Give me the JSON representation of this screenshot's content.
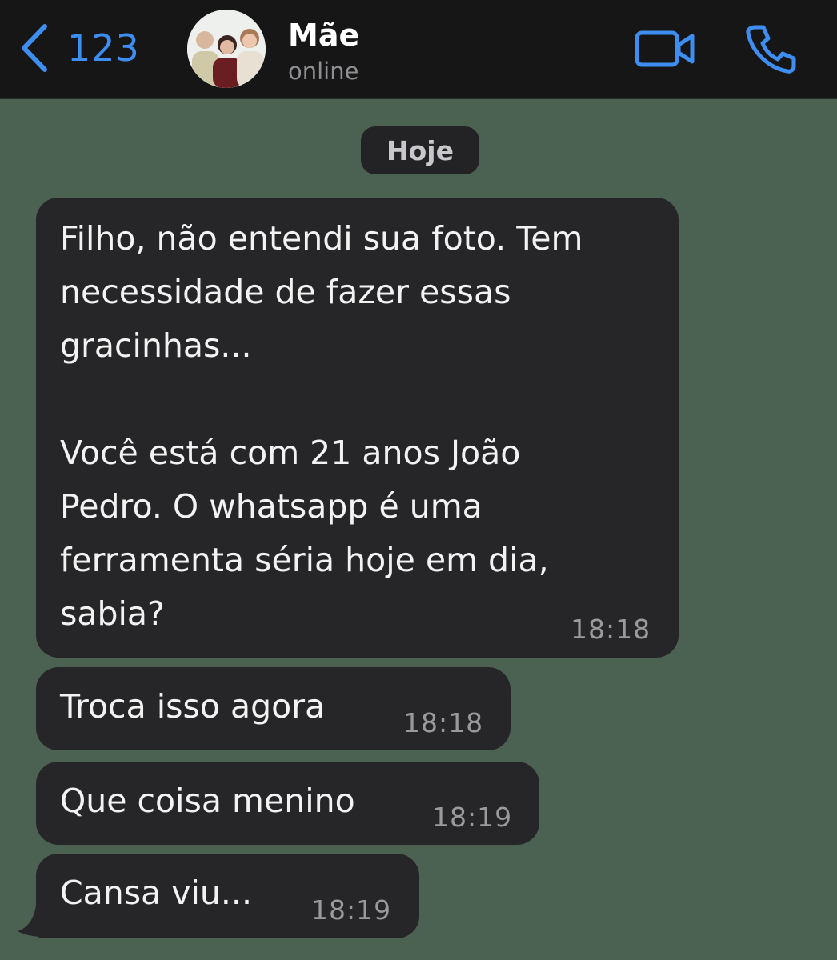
{
  "header": {
    "back_count": "123",
    "contact_name": "Mãe",
    "contact_status": "online",
    "accent_color": "#3d8ef0",
    "icons": [
      "chevron-left-icon",
      "video-camera-icon",
      "phone-icon"
    ]
  },
  "date_separator": "Hoje",
  "messages": [
    {
      "text": "Filho, não entendi sua foto. Tem\nnecessidade de fazer essas\ngracinhas...\n\nVocê está com 21 anos João\nPedro. O whatsapp é uma\nferramenta séria hoje em dia,\nsabia?",
      "time": "18:18"
    },
    {
      "text": "Troca isso agora",
      "time": "18:18"
    },
    {
      "text": "Que coisa menino",
      "time": "18:19"
    },
    {
      "text": "Cansa viu...",
      "time": "18:19"
    }
  ],
  "colors": {
    "chat_background": "#4b6252",
    "header_background": "#161616",
    "bubble_background": "#262628"
  }
}
